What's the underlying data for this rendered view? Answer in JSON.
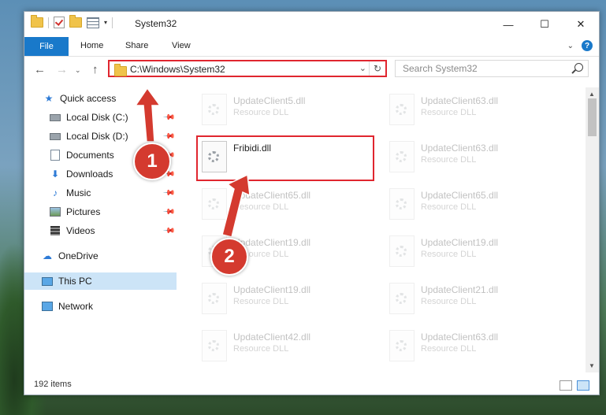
{
  "window": {
    "title": "System32",
    "buttons": [
      "—",
      "☐",
      "✕"
    ]
  },
  "ribbon": {
    "file": "File",
    "tabs": [
      "Home",
      "Share",
      "View"
    ],
    "help": "?"
  },
  "address": {
    "path": "C:\\Windows\\System32",
    "search_placeholder": "Search System32"
  },
  "sidebar": {
    "items": [
      {
        "label": "Quick access",
        "icon": "star-icon",
        "pinned": false
      },
      {
        "label": "Local Disk (C:)",
        "icon": "drive-icon",
        "pinned": true
      },
      {
        "label": "Local Disk (D:)",
        "icon": "drive-icon",
        "pinned": true
      },
      {
        "label": "Documents",
        "icon": "document-icon",
        "pinned": true
      },
      {
        "label": "Downloads",
        "icon": "download-icon",
        "pinned": true
      },
      {
        "label": "Music",
        "icon": "music-icon",
        "pinned": true
      },
      {
        "label": "Pictures",
        "icon": "pictures-icon",
        "pinned": true
      },
      {
        "label": "Videos",
        "icon": "video-icon",
        "pinned": true
      },
      {
        "label": "OneDrive",
        "icon": "cloud-icon",
        "pinned": false
      },
      {
        "label": "This PC",
        "icon": "computer-icon",
        "pinned": false,
        "selected": true
      },
      {
        "label": "Network",
        "icon": "network-icon",
        "pinned": false
      }
    ]
  },
  "files": [
    {
      "name": "UpdateClient5.dll",
      "type": "Resource DLL",
      "faded": true
    },
    {
      "name": "UpdateClient63.dll",
      "type": "Resource DLL",
      "faded": true
    },
    {
      "name": "Fribidi.dll",
      "type": "",
      "faded": false
    },
    {
      "name": "UpdateClient63.dll",
      "type": "Resource DLL",
      "faded": true
    },
    {
      "name": "UpdateClient65.dll",
      "type": "Resource DLL",
      "faded": true
    },
    {
      "name": "UpdateClient65.dll",
      "type": "Resource DLL",
      "faded": true
    },
    {
      "name": "UpdateClient19.dll",
      "type": "Resource DLL",
      "faded": true
    },
    {
      "name": "UpdateClient19.dll",
      "type": "Resource DLL",
      "faded": true
    },
    {
      "name": "UpdateClient19.dll",
      "type": "Resource DLL",
      "faded": true
    },
    {
      "name": "UpdateClient21.dll",
      "type": "Resource DLL",
      "faded": true
    },
    {
      "name": "UpdateClient42.dll",
      "type": "Resource DLL",
      "faded": true
    },
    {
      "name": "UpdateClient63.dll",
      "type": "Resource DLL",
      "faded": true
    }
  ],
  "status": {
    "count": "192 items"
  },
  "annotations": {
    "step1": "1",
    "step2": "2",
    "color": "#d43a2f"
  }
}
